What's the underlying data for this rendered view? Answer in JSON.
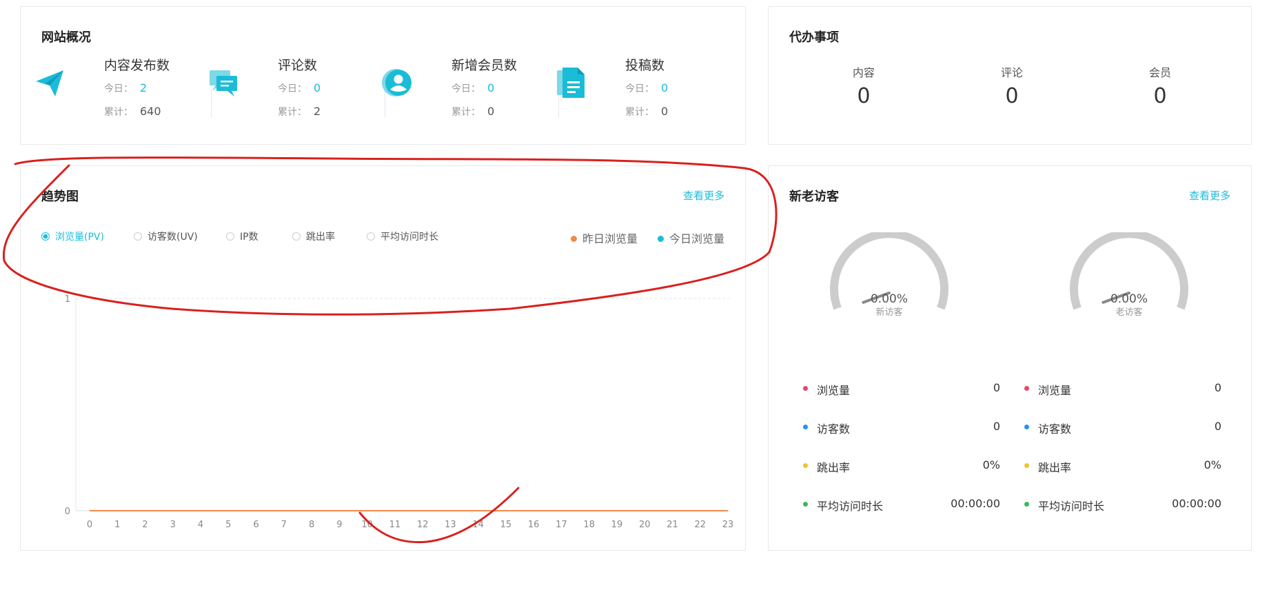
{
  "overview": {
    "title": "网站概况",
    "items": [
      {
        "label": "内容发布数",
        "icon": "paper-plane-icon",
        "today_label": "今日：",
        "today": "2",
        "total_label": "累计：",
        "total": "640"
      },
      {
        "label": "评论数",
        "icon": "chat-bubbles-icon",
        "today_label": "今日：",
        "today": "0",
        "total_label": "累计：",
        "total": "2"
      },
      {
        "label": "新增会员数",
        "icon": "user-icon",
        "today_label": "今日：",
        "today": "0",
        "total_label": "累计：",
        "total": "0"
      },
      {
        "label": "投稿数",
        "icon": "document-icon",
        "today_label": "今日：",
        "today": "0",
        "total_label": "累计：",
        "total": "0"
      }
    ]
  },
  "todo": {
    "title": "代办事项",
    "items": [
      {
        "label": "内容",
        "value": "0"
      },
      {
        "label": "评论",
        "value": "0"
      },
      {
        "label": "会员",
        "value": "0"
      }
    ]
  },
  "trend": {
    "title": "趋势图",
    "more": "查看更多",
    "options": [
      "浏览量(PV)",
      "访客数(UV)",
      "IP数",
      "跳出率",
      "平均访问时长"
    ],
    "selected": 0,
    "legend": [
      {
        "name": "昨日浏览量",
        "color": "#f08a4b"
      },
      {
        "name": "今日浏览量",
        "color": "#1bbcd8"
      }
    ]
  },
  "chart_data": {
    "type": "line",
    "x": [
      0,
      1,
      2,
      3,
      4,
      5,
      6,
      7,
      8,
      9,
      10,
      11,
      12,
      13,
      14,
      15,
      16,
      17,
      18,
      19,
      20,
      21,
      22,
      23
    ],
    "x_tick_labels": [
      "0",
      "1",
      "2",
      "3",
      "4",
      "5",
      "6",
      "7",
      "8",
      "9",
      "10",
      "11",
      "12",
      "13",
      "14",
      "15",
      "16",
      "17",
      "18",
      "19",
      "20",
      "21",
      "22",
      "23"
    ],
    "y_tick_labels": [
      "0",
      "1"
    ],
    "ylim": [
      0,
      1
    ],
    "series": [
      {
        "name": "昨日浏览量",
        "color": "#f08a4b",
        "values": [
          0,
          0,
          0,
          0,
          0,
          0,
          0,
          0,
          0,
          0,
          0,
          0,
          0,
          0,
          0,
          0,
          0,
          0,
          0,
          0,
          0,
          0,
          0,
          0
        ]
      },
      {
        "name": "今日浏览量",
        "color": "#1bbcd8",
        "values": [
          0,
          0,
          0,
          0,
          0,
          0,
          0,
          0,
          0,
          0,
          0,
          0,
          0,
          0,
          0,
          0,
          0,
          0,
          0,
          0,
          0,
          0,
          0,
          0
        ]
      }
    ],
    "grid": true,
    "legend_position": "top-right"
  },
  "visitors": {
    "title": "新老访客",
    "more": "查看更多",
    "gauges": [
      {
        "value": "0.00%",
        "label": "新访客",
        "fraction": 0
      },
      {
        "value": "0.00%",
        "label": "老访客",
        "fraction": 0
      }
    ],
    "stats": [
      [
        {
          "label": "浏览量",
          "value": "0",
          "color": "#e8456b"
        },
        {
          "label": "访客数",
          "value": "0",
          "color": "#2c8ef2"
        },
        {
          "label": "跳出率",
          "value": "0%",
          "color": "#f3c22b"
        },
        {
          "label": "平均访问时长",
          "value": "00:00:00",
          "color": "#3cb955"
        }
      ],
      [
        {
          "label": "浏览量",
          "value": "0",
          "color": "#e8456b"
        },
        {
          "label": "访客数",
          "value": "0",
          "color": "#2c8ef2"
        },
        {
          "label": "跳出率",
          "value": "0%",
          "color": "#f3c22b"
        },
        {
          "label": "平均访问时长",
          "value": "00:00:00",
          "color": "#3cb955"
        }
      ]
    ]
  },
  "colors": {
    "accent": "#1bbcd8",
    "annotation": "#d9201e"
  }
}
